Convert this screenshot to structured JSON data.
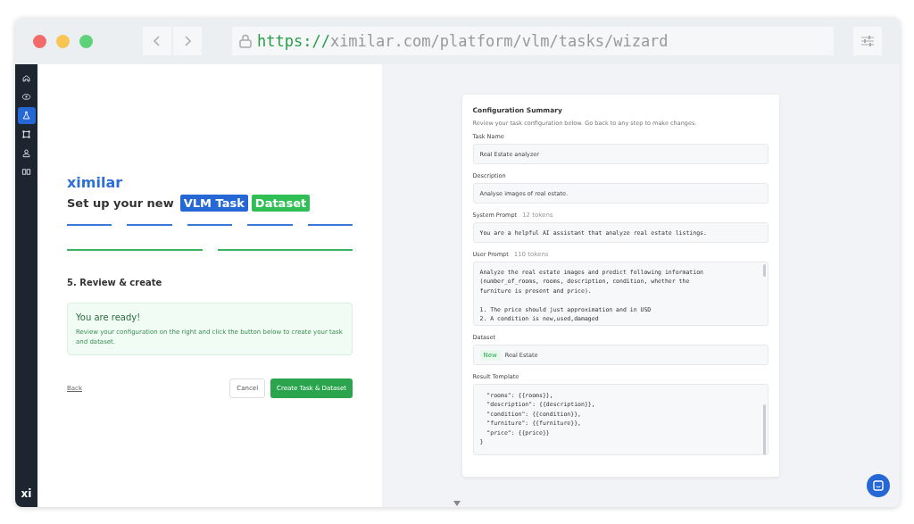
{
  "browser": {
    "url_scheme": "https://",
    "url_rest": "ximilar.com/platform/vlm/tasks/wizard"
  },
  "sidebar": {
    "items": [
      {
        "selected": false
      },
      {
        "selected": false
      },
      {
        "selected": true
      },
      {
        "selected": false
      },
      {
        "selected": false
      },
      {
        "selected": false
      }
    ],
    "footer_logo": "xi"
  },
  "wizard": {
    "logo": "ximilar",
    "heading": "Set up your new",
    "badges": [
      {
        "label": "VLM Task",
        "kind": "task"
      },
      {
        "label": "Dataset",
        "kind": "dataset"
      }
    ],
    "task_steps": [
      {
        "done": true
      },
      {
        "done": true
      },
      {
        "done": true
      },
      {
        "done": true
      },
      {
        "done": true
      }
    ],
    "dataset_steps": [
      {
        "done": true
      },
      {
        "done": true
      }
    ],
    "step_title": "5. Review & create",
    "notice": {
      "title": "You are ready!",
      "text": "Review your configuration on the right and click the button below to create your task and dataset."
    },
    "back_link": "Back",
    "cancel_button": "Cancel",
    "create_button": "Create Task & Dataset"
  },
  "summary": {
    "title": "Configuration Summary",
    "subtitle": "Review your task configuration below. Go back to any step to make changes.",
    "fields": [
      {
        "kind": "text",
        "label": "Task Name",
        "value": "Real Estate analyzer"
      },
      {
        "kind": "text",
        "label": "Description",
        "value": "Analyse images of real estate."
      },
      {
        "kind": "code",
        "label": "System Prompt",
        "tokens": "12 tokens",
        "value": "You are a helpful AI assistant that analyze real estate listings."
      },
      {
        "kind": "code_scroll",
        "label": "User Prompt",
        "tokens": "110 tokens",
        "value": "Analyze the real estate images and predict following information\n(number_of_rooms, rooms, description, condition, whether the\nfurniture is present and price).\n\n1. The price should just approximation and in USD\n2. A condition is new,used,damaged"
      },
      {
        "kind": "dataset",
        "label": "Dataset",
        "tag": "New",
        "value": "Real Estate"
      },
      {
        "kind": "template",
        "label": "Result Template",
        "value": "  \"rooms\": {{rooms}},\n  \"description\": {{description}},\n  \"condition\": {{condition}},\n  \"furniture\": {{furniture}},\n  \"price\": {{price}}\n}"
      }
    ]
  }
}
